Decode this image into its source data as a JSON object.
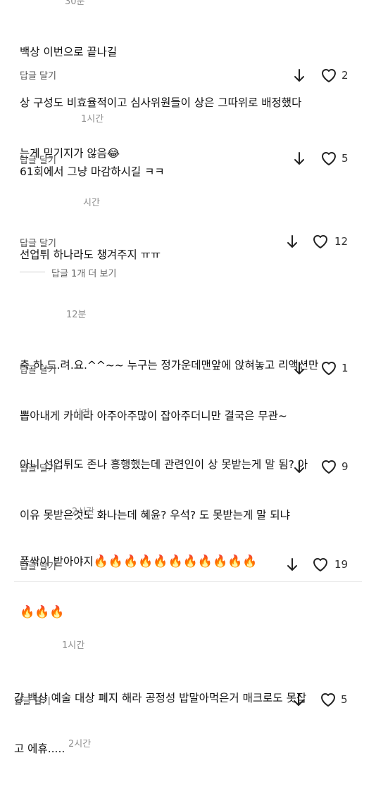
{
  "reply_label": "답글 달기",
  "more_replies": "답글 1개 더 보기",
  "comments": [
    {
      "time": "30분",
      "lines": [
        "백상 이번으로 끝나길",
        "상 구성도 비효율적이고 심사위원들이 상은 그따위로 배정했다",
        "는게 믿기지가 않음😂"
      ],
      "likes": "2"
    },
    {
      "time": "1시간",
      "lines": [
        "61회에서 그냥 마감하시길 ㅋㅋ"
      ],
      "likes": "5"
    },
    {
      "time": "시간",
      "lines": [
        "선업튀 하나라도 챙겨주지 ㅠㅠ"
      ],
      "likes": "12"
    },
    {
      "time": "12분",
      "lines": [
        "축.하.드.려.요.^^~~ 누구는 정가운데맨앞에 앉혀놓고 리액션만",
        "뽑아내게 카메라 아주아주많이 잡아주더니만 결국은 무관~"
      ],
      "likes": "1"
    },
    {
      "time": "시간",
      "lines": [
        "아니 선업튀도 존나 흥행했는데 관련인이 상 못받는게 말 됨? 아",
        "이유 못받은것도 화나는데 혜윤? 우석? 도 못받는게 말 되냐"
      ],
      "likes": "9"
    },
    {
      "time": "2시간",
      "lines": [
        "폭싹이 받아야지",
        ""
      ],
      "fire_line1": "🔥🔥🔥🔥🔥🔥🔥🔥🔥🔥🔥",
      "fire_line2": "🔥🔥🔥",
      "likes": "19"
    },
    {
      "time": "1시간",
      "lines": [
        "걍 백상 예술 대상 폐지 해라 공정성 밥말아먹은거 매크로도 못잡",
        "고 에휴....."
      ],
      "likes": "5"
    },
    {
      "time": "2시간",
      "lines": [],
      "likes": ""
    }
  ]
}
